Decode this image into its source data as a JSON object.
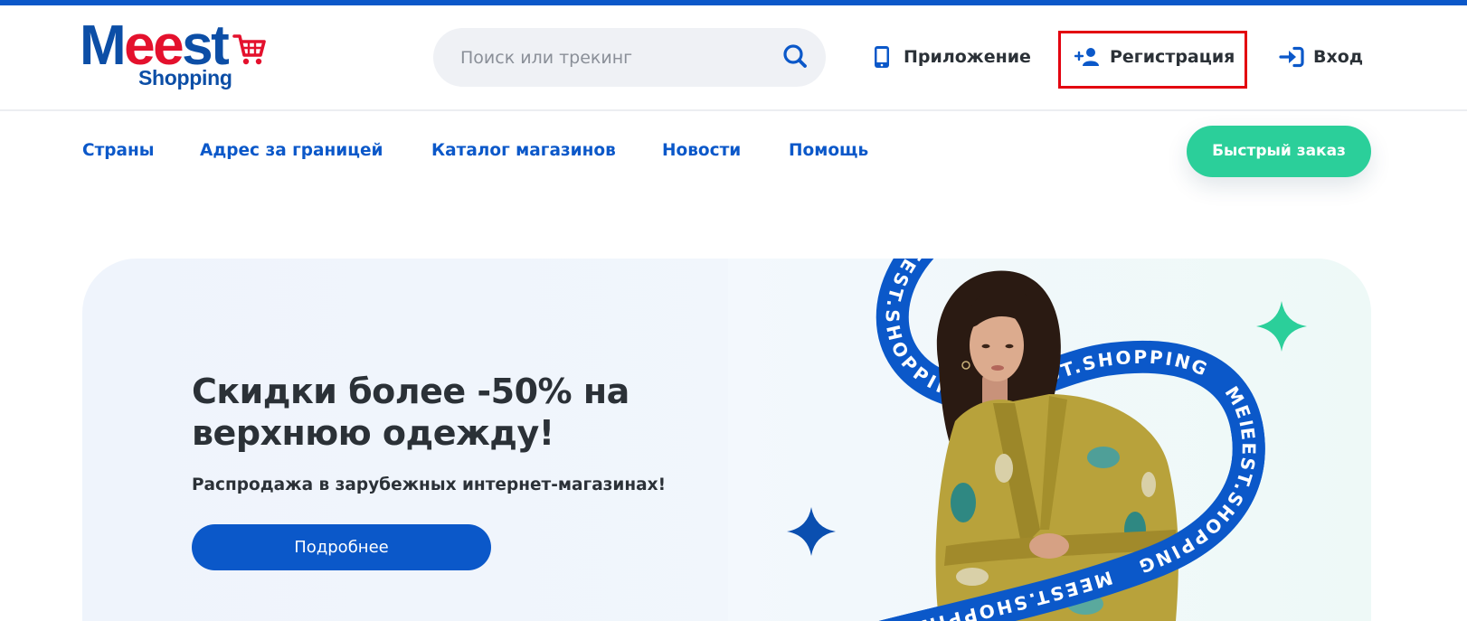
{
  "colors": {
    "brand_blue": "#0b58c9",
    "logo_blue": "#0c4ea6",
    "accent_green": "#2bcf9a",
    "logo_red": "#e4112d",
    "highlight_red": "#e3000f",
    "text_dark": "#2b3137"
  },
  "logo": {
    "word_parts": [
      "M",
      "ee",
      "st"
    ],
    "sub": "Shopping",
    "icon": "shopping-cart-icon"
  },
  "search": {
    "placeholder": "Поиск или трекинг",
    "value": "",
    "icon": "search-icon"
  },
  "header_links": {
    "app": {
      "label": "Приложение",
      "icon": "phone-icon"
    },
    "register": {
      "label": "Регистрация",
      "icon": "add-user-icon"
    },
    "login": {
      "label": "Вход",
      "icon": "sign-in-icon"
    }
  },
  "nav": {
    "items": [
      {
        "label": "Страны"
      },
      {
        "label": "Адрес за границей"
      },
      {
        "label": "Каталог магазинов"
      },
      {
        "label": "Новости"
      },
      {
        "label": "Помощь"
      }
    ]
  },
  "quick_order": {
    "label": "Быстрый заказ"
  },
  "hero": {
    "heading_line1": "Скидки более -50% на",
    "heading_line2": "верхнюю одежду!",
    "subtitle": "Распродажа в зарубежных интернет-магазинах!",
    "button_label": "Подробнее",
    "ribbon_text": "MEEST.SHOPPING",
    "decor_icons": [
      "four-point-star-icon",
      "four-point-star-icon"
    ]
  }
}
